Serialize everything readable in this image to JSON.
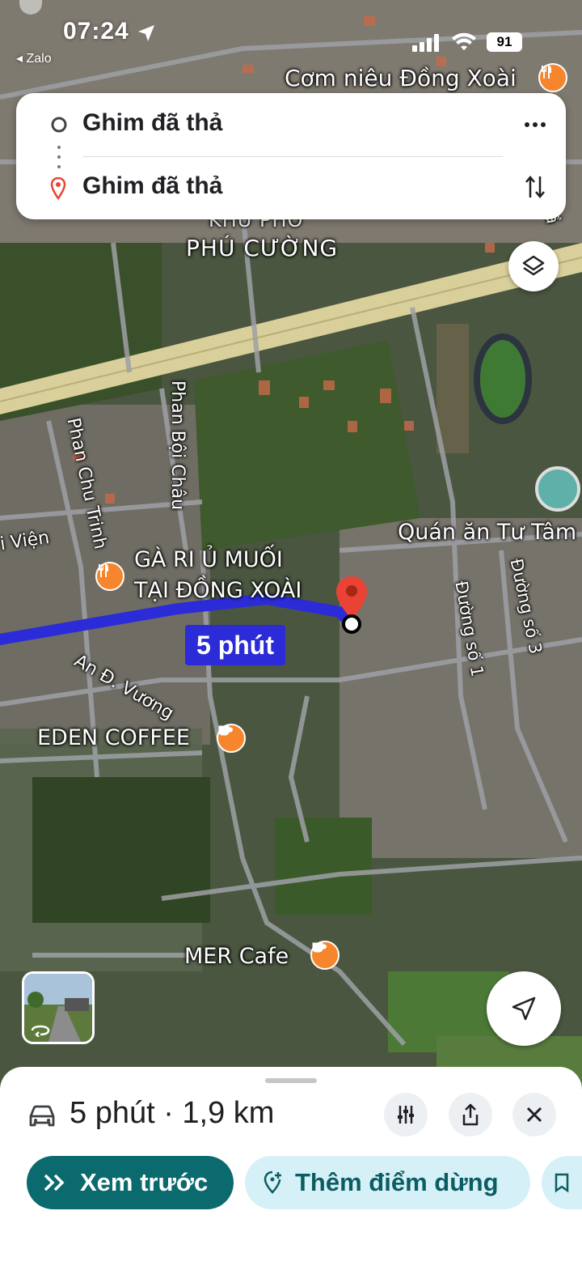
{
  "status_bar": {
    "time": "07:24",
    "back_app": "Zalo",
    "battery": "91"
  },
  "directions": {
    "origin": "Ghim đã thả",
    "destination": "Ghim đã thả"
  },
  "map": {
    "labels": {
      "com_nieu": "Cơm niêu Đồng Xoài",
      "khu_pho": "KHU PHỐ",
      "phu_cuong": "PHÚ CƯỜNG",
      "phan_boi_chau": "Phan Bội Châu",
      "phan_chu_trinh": "Phan Chu Trinh",
      "vien": "i Viện",
      "ga_ri_line1": "GÀ RI Ủ MUỐI",
      "ga_ri_line2": "TẠI ĐỒNG XOÀI",
      "quan_an": "Quán ăn Tư Tâm",
      "duong_so_1": "Đường số 1",
      "duong_so_3": "Đường số 3",
      "an_d_vuong": "An Đ. Vương",
      "eden": "EDEN COFFEE",
      "mer": "MER Cafe",
      "tra": "Trầ"
    },
    "route_time": "5 phút"
  },
  "trip": {
    "summary": "5 phút · 1,9 km",
    "preview_label": "Xem trước",
    "add_stop_label": "Thêm điểm dừng"
  },
  "colors": {
    "route": "#2b2bd8",
    "pin": "#ea4335",
    "food_poi": "#f5862e",
    "cafe_poi": "#f5862e",
    "teal_button": "#0b6a6e",
    "light_pill": "#d5f0f7"
  },
  "icons": [
    "car-icon",
    "filter-icon",
    "share-icon",
    "close-icon",
    "layers-icon",
    "navigate-icon",
    "more-icon",
    "swap-icon",
    "pin-icon",
    "restaurant-icon",
    "cafe-icon"
  ]
}
